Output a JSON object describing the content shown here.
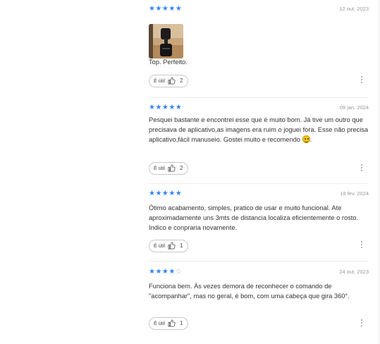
{
  "reviews": [
    {
      "rating": 5,
      "date": "12 out. 2023",
      "has_photo": true,
      "text": "Top. Perfeito.",
      "helpful_label": "É útil",
      "helpful_count": "2"
    },
    {
      "rating": 5,
      "date": "09 jan. 2024",
      "has_photo": false,
      "text": "Pesquei bastante e encontrei esse que é muito bom. Já tive um outro que precisava de aplicativo,as imagens era ruim o joguei fora. Esse não precisa aplicativo,fácil manuseio. Gostei muito e recomendo",
      "helpful_label": "É útil",
      "helpful_count": "2"
    },
    {
      "rating": 5,
      "date": "18 fev. 2024",
      "has_photo": false,
      "text": "Ótimo acabamento, simples, pratico de usar e muito funcional. Ate aproximadamente uns 3mts de distancia localiza eficientemente o rosto. Indico e conpraria novamente.",
      "helpful_label": "É útil",
      "helpful_count": "1"
    },
    {
      "rating": 4,
      "date": "24 out. 2023",
      "has_photo": false,
      "text": "Funciona bem. Às vezes demora de reconhecer o comando de \"acompanhar\", mas no geral, é bom, com uma cabeça que gira 360°.",
      "helpful_label": "É útil",
      "helpful_count": "1"
    }
  ],
  "colors": {
    "star": "#3483fa",
    "star_empty": "#9bbcf0"
  },
  "icons": {
    "rating": "star-icon",
    "helpful": "thumbs-up-icon",
    "more": "more-vertical-icon",
    "emoji": "smiley-emoji-icon"
  }
}
